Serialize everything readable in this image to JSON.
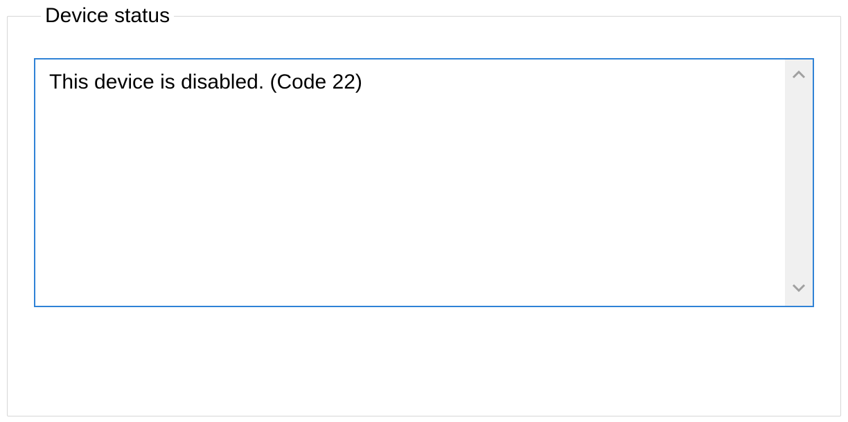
{
  "device_status": {
    "legend": "Device status",
    "message": "This device is disabled. (Code 22)"
  }
}
